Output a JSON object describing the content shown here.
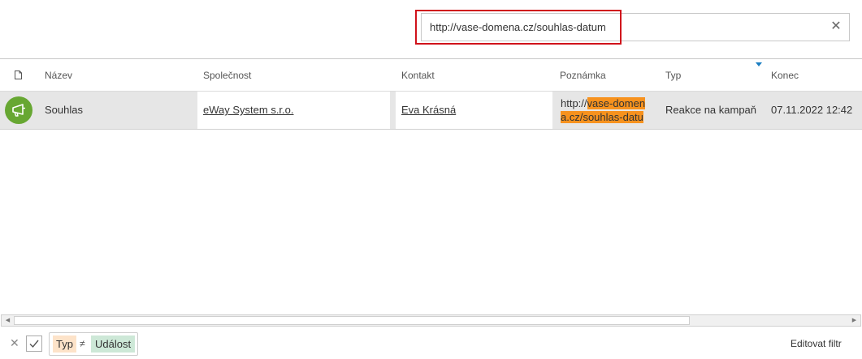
{
  "search": {
    "value": "http://vase-domena.cz/souhlas-datum",
    "clear_icon": "close-icon"
  },
  "columns": [
    "Název",
    "Společnost",
    "Kontakt",
    "Poznámka",
    "Typ",
    "Konec"
  ],
  "row": {
    "icon": "megaphone-icon",
    "icon_color": "#67a732",
    "name": "Souhlas",
    "company": "eWay System s.r.o.",
    "contact": "Eva Krásná",
    "note": {
      "plain": "http://",
      "highlight_1": "vase-domen",
      "highlight_2": "a.cz/souhlas-datu"
    },
    "type": "Reakce na kampaň",
    "end": "07.11.2022 12:42"
  },
  "filter": {
    "field": "Typ",
    "operator": "≠",
    "value": "Událost",
    "edit_label": "Editovat filtr"
  },
  "colors": {
    "highlight": "#f7921e",
    "red_frame": "#d0121b",
    "sort_marker": "#1b7ec2"
  }
}
